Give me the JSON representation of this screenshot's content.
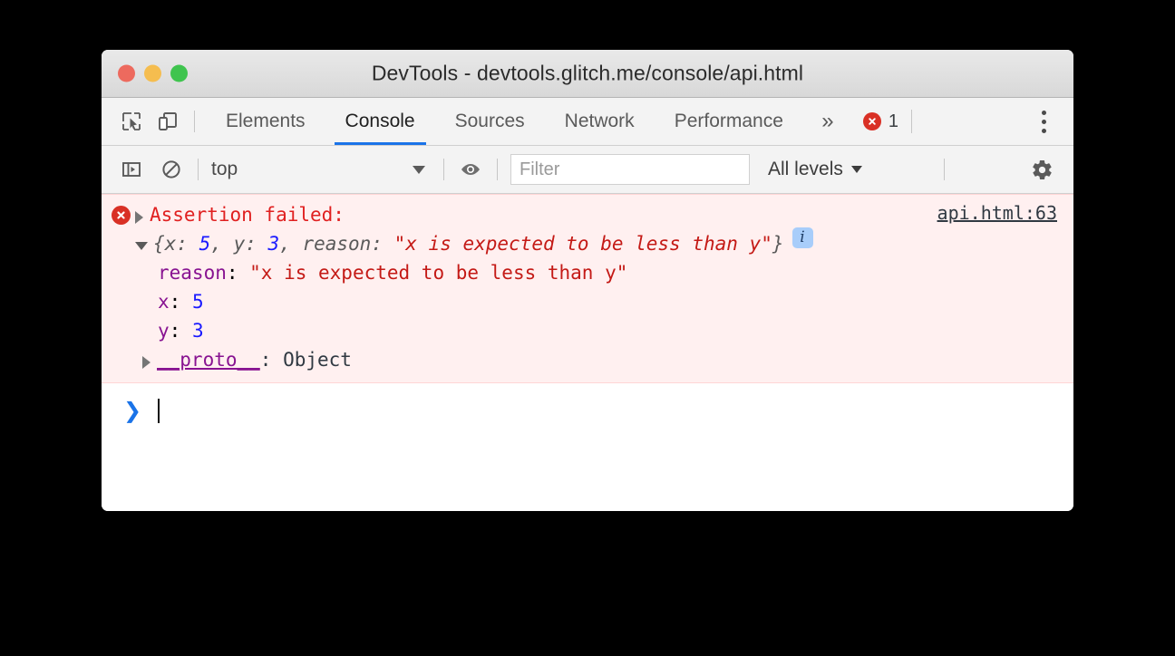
{
  "window": {
    "title": "DevTools - devtools.glitch.me/console/api.html",
    "traffic_lights": [
      {
        "name": "close",
        "color": "#ed6a5e"
      },
      {
        "name": "minimize",
        "color": "#f5bd4f"
      },
      {
        "name": "zoom",
        "color": "#3fc44e"
      }
    ]
  },
  "tabbar": {
    "inspect_icon": "inspect-element-icon",
    "device_icon": "device-toolbar-icon",
    "tabs": [
      {
        "label": "Elements",
        "active": false
      },
      {
        "label": "Console",
        "active": true
      },
      {
        "label": "Sources",
        "active": false
      },
      {
        "label": "Network",
        "active": false
      },
      {
        "label": "Performance",
        "active": false
      }
    ],
    "overflow_label": "»",
    "error_count": "1",
    "more_icon": "kebab-menu-icon",
    "active_tab_color": "#1a73e8",
    "error_color": "#d93025"
  },
  "console_toolbar": {
    "sidebar_toggle_icon": "sidebar-toggle-icon",
    "clear_icon": "clear-console-icon",
    "context": "top",
    "eye_icon": "create-live-expression-icon",
    "filter_placeholder": "Filter",
    "levels": "All levels",
    "settings_icon": "settings-gear-icon"
  },
  "console": {
    "error_message": {
      "level_icon": "error-icon",
      "text": "Assertion failed:",
      "source": "api.html:63",
      "preview": {
        "open_brace": "{",
        "entries": [
          {
            "key": "x",
            "sep": ": ",
            "value": "5",
            "type": "number"
          },
          {
            "key": "y",
            "sep": ": ",
            "value": "3",
            "type": "number"
          },
          {
            "key": "reason",
            "sep": ": ",
            "value": "\"x is expected to be less than y\"",
            "type": "string"
          }
        ],
        "close_brace": "}",
        "info_badge": "i"
      },
      "properties": [
        {
          "name": "reason",
          "value": "\"x is expected to be less than y\"",
          "type": "string"
        },
        {
          "name": "x",
          "value": "5",
          "type": "number"
        },
        {
          "name": "y",
          "value": "3",
          "type": "number"
        }
      ],
      "proto": {
        "name": "__proto__",
        "value": "Object"
      }
    },
    "prompt": {
      "chevron": "›",
      "input_value": ""
    }
  },
  "colors": {
    "error_text": "#e02020",
    "error_background": "#fff0f0",
    "string_value": "#c41a16",
    "number_value": "#1a1aff",
    "property_name": "#881391",
    "accent": "#1a73e8"
  }
}
